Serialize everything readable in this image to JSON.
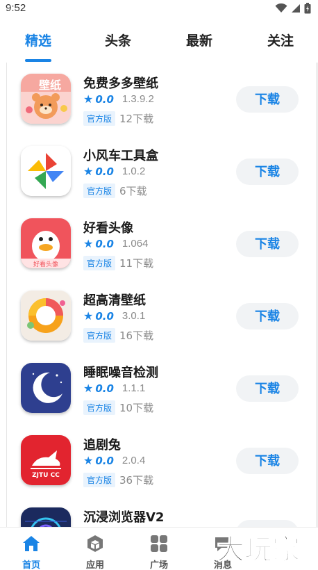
{
  "status_bar": {
    "time": "9:52"
  },
  "top_tabs": [
    {
      "label": "精选",
      "active": true
    },
    {
      "label": "头条",
      "active": false
    },
    {
      "label": "最新",
      "active": false
    },
    {
      "label": "关注",
      "active": false
    }
  ],
  "apps": [
    {
      "name": "免费多多壁纸",
      "rating": "0.0",
      "version": "1.3.9.2",
      "badge": "官方版",
      "downloads": "12下载",
      "button": "下载",
      "icon": "wallpaper-bear-icon",
      "icon_text": "壁纸"
    },
    {
      "name": "小风车工具盒",
      "rating": "0.0",
      "version": "1.0.2",
      "badge": "官方版",
      "downloads": "6下载",
      "button": "下载",
      "icon": "pinwheel-icon"
    },
    {
      "name": "好看头像",
      "rating": "0.0",
      "version": "1.064",
      "badge": "官方版",
      "downloads": "11下载",
      "button": "下载",
      "icon": "duck-avatar-icon",
      "icon_text": "好看头像"
    },
    {
      "name": "超高清壁纸",
      "rating": "0.0",
      "version": "3.0.1",
      "badge": "官方版",
      "downloads": "16下载",
      "button": "下载",
      "icon": "color-ring-icon"
    },
    {
      "name": "睡眠噪音检测",
      "rating": "0.0",
      "version": "1.1.1",
      "badge": "官方版",
      "downloads": "10下载",
      "button": "下载",
      "icon": "moon-icon"
    },
    {
      "name": "追剧兔",
      "rating": "0.0",
      "version": "2.0.4",
      "badge": "官方版",
      "downloads": "36下载",
      "button": "下载",
      "icon": "rabbit-icon",
      "icon_text": "ZJTU CC"
    },
    {
      "name": "沉浸浏览器V2",
      "rating": "",
      "version": "",
      "badge": "",
      "downloads": "",
      "button": "",
      "icon": "browser-icon"
    }
  ],
  "bottom_nav": [
    {
      "label": "首页",
      "icon": "home-icon",
      "active": true
    },
    {
      "label": "应用",
      "icon": "cube-icon",
      "active": false
    },
    {
      "label": "广场",
      "icon": "grid-icon",
      "active": false
    },
    {
      "label": "消息",
      "icon": "message-icon",
      "active": false
    }
  ],
  "watermark": {
    "text": "大玩家"
  },
  "colors": {
    "accent": "#1a84e5",
    "button_bg": "#f1f3f5",
    "badge_bg": "#e9f3fd",
    "muted": "#8a8a8a"
  }
}
